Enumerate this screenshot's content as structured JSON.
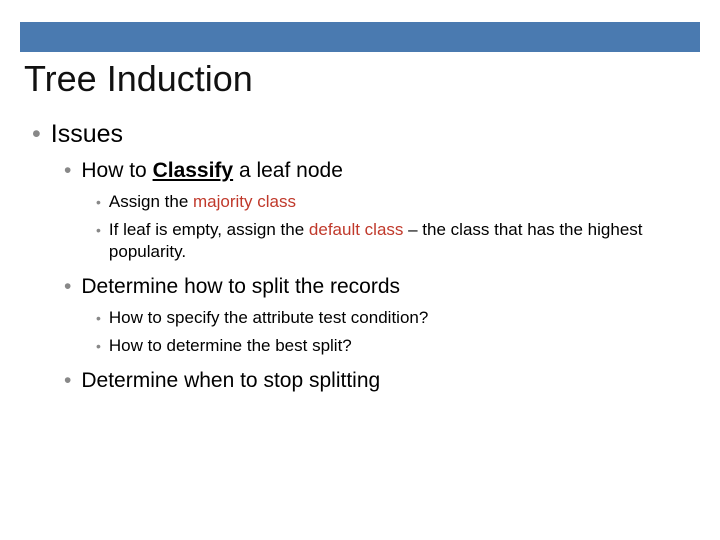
{
  "title": "Tree Induction",
  "l1_issues": "Issues",
  "l2_classify_pre": "How to ",
  "l2_classify_bold": "Classify",
  "l2_classify_post": " a leaf node",
  "l3_assign_pre": "Assign the ",
  "l3_assign_red": "majority class",
  "l3_default_pre": "If leaf is empty, assign the ",
  "l3_default_red": "default class",
  "l3_default_post": " – the class that has the highest popularity.",
  "l2_split": "Determine how to split the records",
  "l3_split_q1": "How to specify the attribute test condition?",
  "l3_split_q2": "How to determine the best split?",
  "l2_stop": "Determine when to stop splitting"
}
